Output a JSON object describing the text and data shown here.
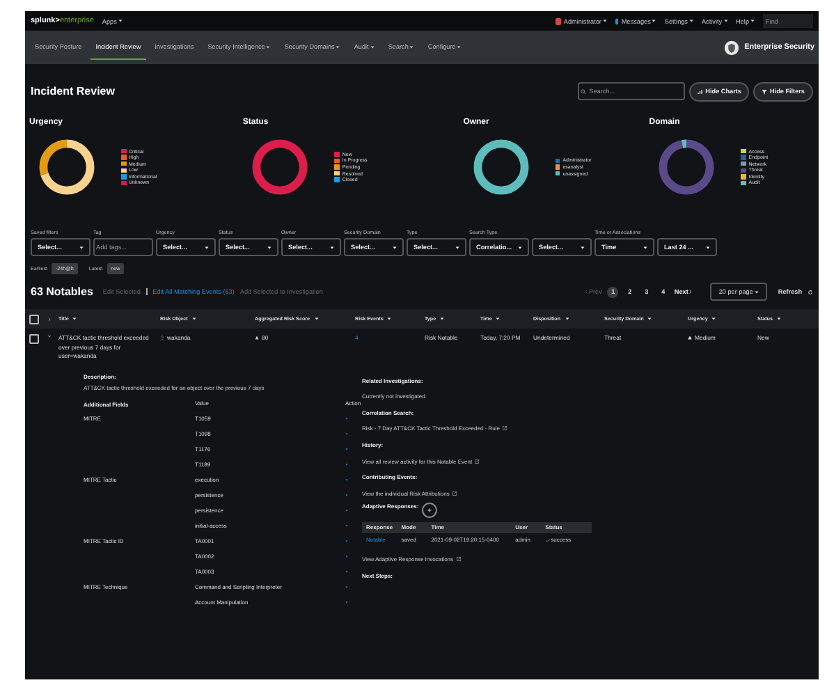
{
  "top_bar": {
    "logo": {
      "brand": "splunk>",
      "product": "enterprise"
    },
    "apps": "Apps",
    "menus": [
      {
        "label": "Administrator",
        "kind": "user"
      },
      {
        "label": "Messages",
        "kind": "messages"
      },
      {
        "label": "Settings",
        "kind": "plain"
      },
      {
        "label": "Activity",
        "kind": "plain"
      },
      {
        "label": "Help",
        "kind": "plain"
      }
    ],
    "find": {
      "placeholder": "Find"
    }
  },
  "nav": {
    "items": [
      {
        "label": "Security Posture",
        "selected": false,
        "dropdown": false
      },
      {
        "label": "Incident Review",
        "selected": true,
        "dropdown": false
      },
      {
        "label": "Investigations",
        "selected": false,
        "dropdown": false
      },
      {
        "label": "Security Intelligence",
        "selected": false,
        "dropdown": true
      },
      {
        "label": "Security Domains",
        "selected": false,
        "dropdown": true
      },
      {
        "label": "Audit",
        "selected": false,
        "dropdown": true
      },
      {
        "label": "Search",
        "selected": false,
        "dropdown": true
      },
      {
        "label": "Configure",
        "selected": false,
        "dropdown": true
      }
    ],
    "app_name": "Enterprise Security"
  },
  "header": {
    "title": "Incident Review",
    "search": {
      "placeholder": "Search..."
    },
    "buttons": [
      {
        "label": "Hide Charts",
        "kind": "charts"
      },
      {
        "label": "Hide Filters",
        "kind": "filters"
      }
    ]
  },
  "charts": [
    {
      "title": "Urgency",
      "legend": [
        {
          "label": "Critical",
          "color": "#dc1e4b"
        },
        {
          "label": "High",
          "color": "#f15a22"
        },
        {
          "label": "Medium",
          "color": "#e39b16"
        },
        {
          "label": "Low",
          "color": "#f8d38f"
        },
        {
          "label": "Informational",
          "color": "#1a9be8"
        },
        {
          "label": "Unknown",
          "color": "#d31b54"
        }
      ]
    },
    {
      "title": "Status",
      "legend": [
        {
          "label": "New",
          "color": "#dc1e4b"
        },
        {
          "label": "In Progress",
          "color": "#f15a22"
        },
        {
          "label": "Pending",
          "color": "#e39b16"
        },
        {
          "label": "Resolved",
          "color": "#f8d38f"
        },
        {
          "label": "Closed",
          "color": "#1a9be8"
        }
      ]
    },
    {
      "title": "Owner",
      "legend": [
        {
          "label": "Administrator",
          "color": "#1473b5"
        },
        {
          "label": "esanalyst",
          "color": "#ef8d58"
        },
        {
          "label": "unassigned",
          "color": "#5fbcbc"
        }
      ]
    },
    {
      "title": "Domain",
      "legend": [
        {
          "label": "Access",
          "color": "#c5d64f"
        },
        {
          "label": "Endpoint",
          "color": "#2d5f8a"
        },
        {
          "label": "Network",
          "color": "#7b9bb5"
        },
        {
          "label": "Threat",
          "color": "#5a4a8a"
        },
        {
          "label": "Identity",
          "color": "#f1b52c"
        },
        {
          "label": "Audit",
          "color": "#5fbcbc"
        }
      ]
    }
  ],
  "filters": [
    {
      "label": "Saved filters",
      "kind": "select",
      "value": "Select..."
    },
    {
      "label": "Tag",
      "kind": "text",
      "placeholder": "Add tags..."
    },
    {
      "label": "Urgency",
      "kind": "select",
      "value": "Select..."
    },
    {
      "label": "Status",
      "kind": "select",
      "value": "Select..."
    },
    {
      "label": "Owner",
      "kind": "select",
      "value": "Select..."
    },
    {
      "label": "Security Domain",
      "kind": "select",
      "value": "Select..."
    },
    {
      "label": "Type",
      "kind": "select",
      "value": "Select..."
    },
    {
      "label": "Search Type",
      "kind": "select",
      "value": "Correlatio..."
    },
    {
      "kind": "select",
      "value": "Select..."
    },
    {
      "label": "Time or Associations",
      "kind": "select",
      "value": "Time"
    },
    {
      "kind": "select",
      "value": "Last 24 ..."
    }
  ],
  "time_range": [
    {
      "label": "Earliest",
      "value": "-24h@h"
    },
    {
      "label": "Latest",
      "value": "now"
    }
  ],
  "notables": {
    "count": "63 Notables",
    "actions": [
      {
        "label": "Edit Selected",
        "disabled": true
      },
      {
        "label": "Edit All Matching Events (63)",
        "disabled": false
      },
      {
        "label": "Add Selected to Investigation",
        "disabled": true
      }
    ],
    "pagination": {
      "prev": {
        "label": "Prev",
        "disabled": true
      },
      "pages": [
        {
          "label": "1",
          "selected": true
        },
        {
          "label": "2",
          "selected": false
        },
        {
          "label": "3",
          "selected": false
        },
        {
          "label": "4",
          "selected": false
        }
      ],
      "next": {
        "label": "Next",
        "disabled": false
      },
      "per_page": "20 per page",
      "refresh": "Refresh"
    }
  },
  "table": {
    "select_all_checked": false,
    "columns": [
      "Title",
      "Risk Object",
      "Aggregated Risk Score",
      "Risk Events",
      "Type",
      "Time",
      "Disposition",
      "Security Domain",
      "Urgency",
      "Status"
    ],
    "rows": [
      {
        "checked": false,
        "expanded": true,
        "title": "ATT&CK tactic threshold exceeded over previous 7 days for user=wakanda",
        "risk_object": "wakanda",
        "risk_score": "80",
        "risk_events": "4",
        "type": "Risk Notable",
        "time": "Today, 7:20 PM",
        "disposition": "Undetermined",
        "security_domain": "Threat",
        "urgency": "Medium",
        "status": "New"
      }
    ]
  },
  "details": {
    "description_label": "Description:",
    "description": "ATT&CK tactic threshold exceeded for an object over the previous 7 days",
    "fields_header": [
      "Additional Fields",
      "Value",
      "Action"
    ],
    "fields": [
      {
        "name": "MITRE",
        "values": [
          "T1059",
          "T1098",
          "T1176",
          "T1189"
        ]
      },
      {
        "name": "MITRE Tactic",
        "values": [
          "execution",
          "persistence",
          "persistence",
          "initial-access"
        ]
      },
      {
        "name": "MITRE Tactic ID",
        "values": [
          "TA0001",
          "TA0002",
          "TA0003"
        ]
      },
      {
        "name": "MITRE Technique",
        "values": [
          "Command and Scripting Interpreter",
          "Account Manipulation"
        ]
      }
    ],
    "sections": [
      {
        "heading": "Related Investigations:",
        "text": "Currently not investigated.",
        "kind": "text"
      },
      {
        "heading": "Correlation Search:",
        "text": "Risk - 7 Day ATT&CK Tactic Threshold Exceeded - Rule",
        "kind": "link"
      },
      {
        "heading": "History:",
        "text": "View all review activity for this Notable Event",
        "kind": "link"
      },
      {
        "heading": "Contributing Events:",
        "text": "View the individual Risk Attributions",
        "kind": "link"
      }
    ],
    "adaptive": {
      "heading": "Adaptive Responses:",
      "columns": [
        "Response",
        "Mode",
        "Time",
        "User",
        "Status"
      ],
      "rows": [
        {
          "response": "Notable",
          "mode": "saved",
          "time": "2021-09-02T19:20:15-0400",
          "user": "admin",
          "status": "success"
        }
      ],
      "link": "View Adaptive Response Invocations"
    },
    "next_steps": "Next Steps:"
  }
}
